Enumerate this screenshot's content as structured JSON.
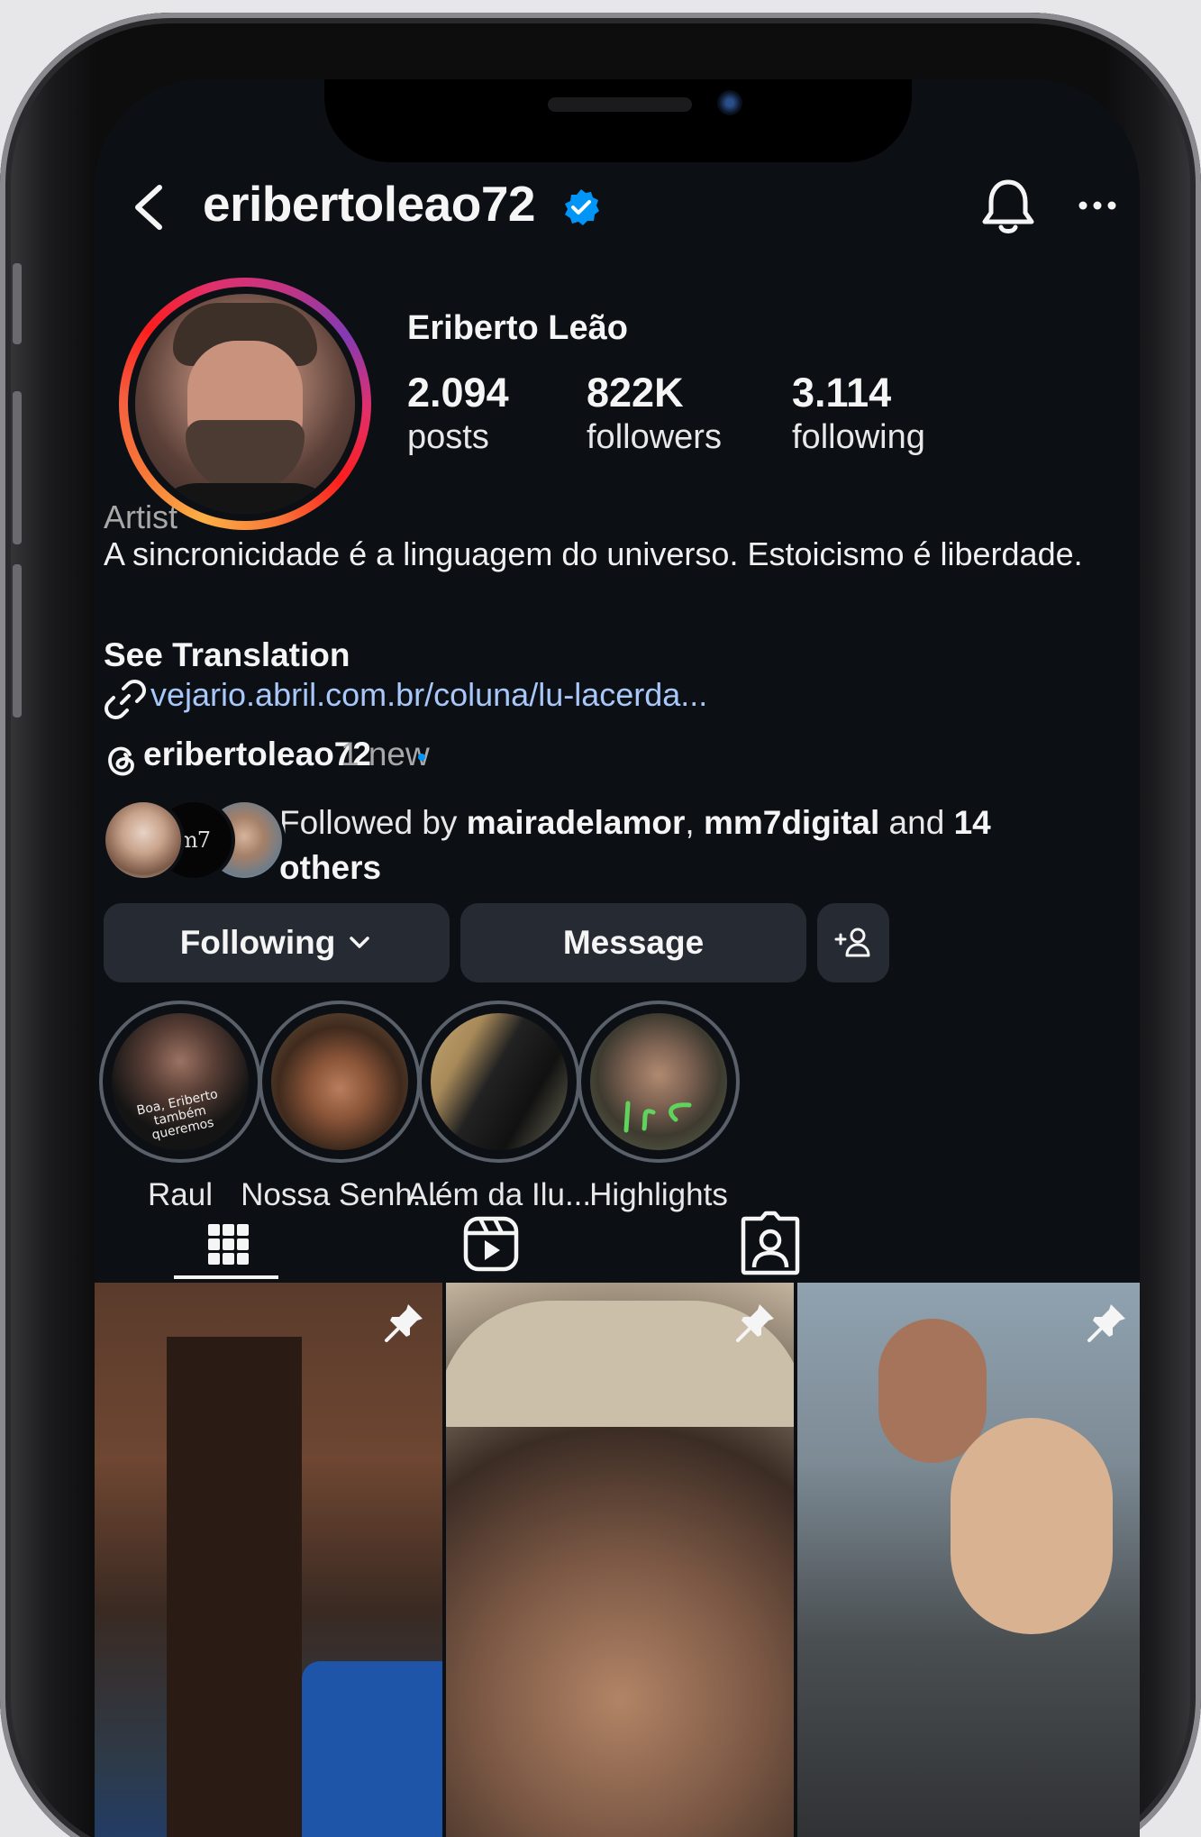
{
  "header": {
    "username": "eribertoleao72"
  },
  "profile": {
    "full_name": "Eriberto Leão",
    "stats": [
      {
        "value": "2.094",
        "label": "posts"
      },
      {
        "value": "822K",
        "label": "followers"
      },
      {
        "value": "3.114",
        "label": "following"
      }
    ],
    "category": "Artist",
    "bio": "A sincronicidade é a linguagem do universo. Estoicismo é liberdade.",
    "see_translation": "See Translation",
    "link": "vejario.abril.com.br/coluna/lu-lacerda...",
    "threads_username": "eribertoleao72",
    "threads_new": "1 new"
  },
  "followed_by": {
    "prefix": "Followed by ",
    "user1": "mairadelamor",
    "sep": ", ",
    "user2": "mm7digital",
    "and": " and ",
    "others_count": "14",
    "others": "others",
    "avatar2_text": "m7"
  },
  "actions": {
    "following_label": "Following",
    "message_label": "Message"
  },
  "highlights": [
    {
      "label": "Raul",
      "overlay": "Boa, Eriberto também queremos"
    },
    {
      "label": "Nossa Senh..."
    },
    {
      "label": "Além da Ilu..."
    },
    {
      "label": "Highlights"
    }
  ],
  "icons": {
    "back": "chevron-left-icon",
    "verified": "verified-badge-icon",
    "bell": "bell-icon",
    "more": "more-horizontal-icon",
    "link": "link-icon",
    "threads": "threads-icon",
    "add_person": "add-person-icon",
    "grid": "grid-icon",
    "reels": "reels-icon",
    "tagged": "tagged-icon",
    "pin": "pin-icon"
  },
  "colors": {
    "background": "#0c1015",
    "button_bg": "#262b33",
    "link": "#a8c7fa",
    "verified": "#0095f6",
    "secondary_text": "#a8a8a8"
  }
}
